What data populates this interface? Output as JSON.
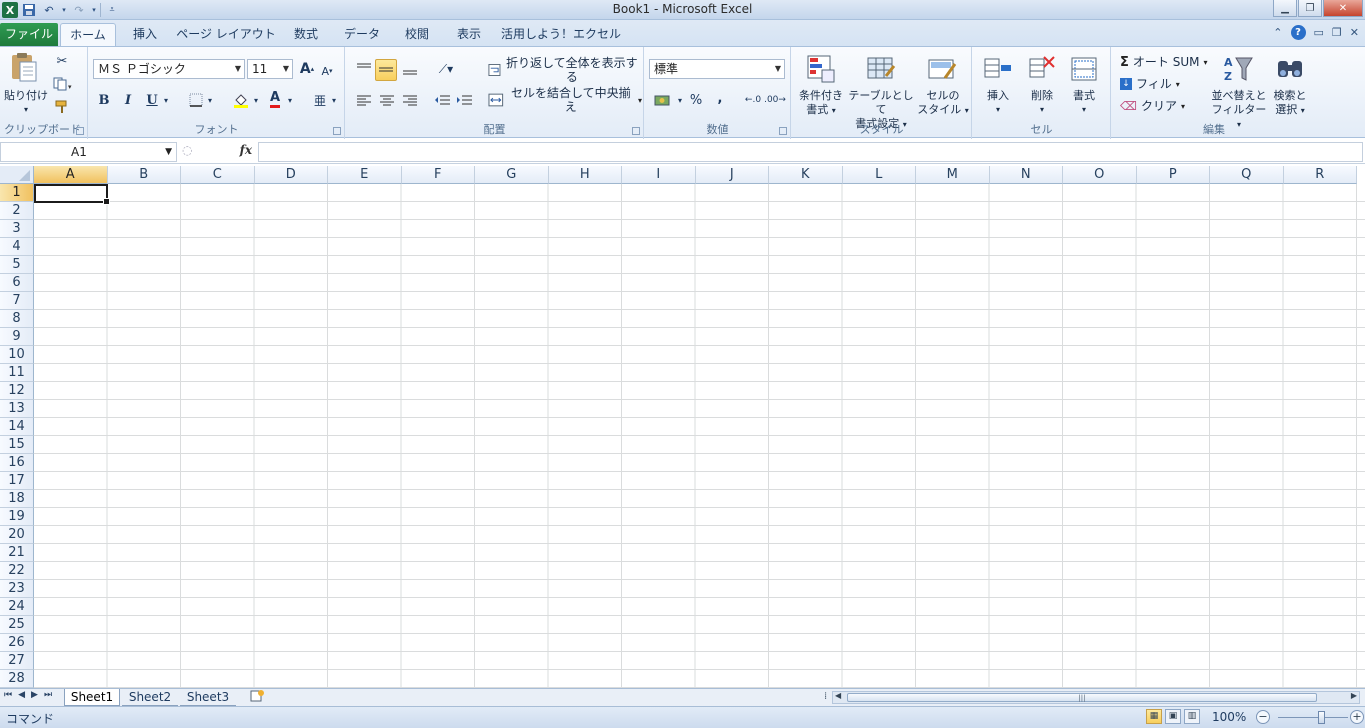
{
  "window": {
    "title": "Book1 - Microsoft Excel",
    "app_icon": "X",
    "min_label": "▁",
    "max_label": "❐",
    "close_label": "✕"
  },
  "ribbon_tabs": [
    {
      "label": "ファイル"
    },
    {
      "label": "ホーム"
    },
    {
      "label": "挿入"
    },
    {
      "label": "ページ レイアウト"
    },
    {
      "label": "数式"
    },
    {
      "label": "データ"
    },
    {
      "label": "校閲"
    },
    {
      "label": "表示"
    },
    {
      "label": "活用しよう！エクセル"
    }
  ],
  "active_tab": "ホーム",
  "ribbon": {
    "clipboard": {
      "label": "クリップボード",
      "paste": "貼り付け"
    },
    "font": {
      "label": "フォント",
      "font_name": "ＭＳ Ｐゴシック",
      "font_size": "11",
      "bold": "B",
      "italic": "I",
      "underline": "U",
      "grow": "A",
      "shrink": "A",
      "font_color": "A"
    },
    "alignment": {
      "label": "配置",
      "wrap_text": "折り返して全体を表示する",
      "merge_center": "セルを結合して中央揃え"
    },
    "number": {
      "label": "数値",
      "format": "標準",
      "percent": "%",
      "comma": ","
    },
    "styles": {
      "label": "スタイル",
      "conditional_1": "条件付き",
      "conditional_2": "書式",
      "table_1": "テーブルとして",
      "table_2": "書式設定",
      "cell_style_1": "セルの",
      "cell_style_2": "スタイル"
    },
    "cells": {
      "label": "セル",
      "insert": "挿入",
      "delete": "削除",
      "format": "書式"
    },
    "editing": {
      "label": "編集",
      "autosum": "オート SUM",
      "fill": "フィル",
      "clear": "クリア",
      "sort_1": "並べ替えと",
      "sort_2": "フィルター",
      "find_1": "検索と",
      "find_2": "選択"
    }
  },
  "formula_bar": {
    "name_box": "A1",
    "fx": "fx",
    "value": ""
  },
  "grid": {
    "columns": [
      "A",
      "B",
      "C",
      "D",
      "E",
      "F",
      "G",
      "H",
      "I",
      "J",
      "K",
      "L",
      "M",
      "N",
      "O",
      "P",
      "Q",
      "R"
    ],
    "rows": [
      "1",
      "2",
      "3",
      "4",
      "5",
      "6",
      "7",
      "8",
      "9",
      "10",
      "11",
      "12",
      "13",
      "14",
      "15",
      "16",
      "17",
      "18",
      "19",
      "20",
      "21",
      "22",
      "23",
      "24",
      "25",
      "26",
      "27",
      "28"
    ],
    "selected_column": "A",
    "selected_row": "1"
  },
  "sheets": [
    {
      "label": "Sheet1"
    },
    {
      "label": "Sheet2"
    },
    {
      "label": "Sheet3"
    }
  ],
  "active_sheet": "Sheet1",
  "status": {
    "mode": "コマンド",
    "zoom": "100%",
    "zoom_value": 100
  },
  "colors": {
    "accent": "#1e7a3c",
    "selection": "#f8cf5d",
    "ribbon": "#e3ecf7"
  }
}
